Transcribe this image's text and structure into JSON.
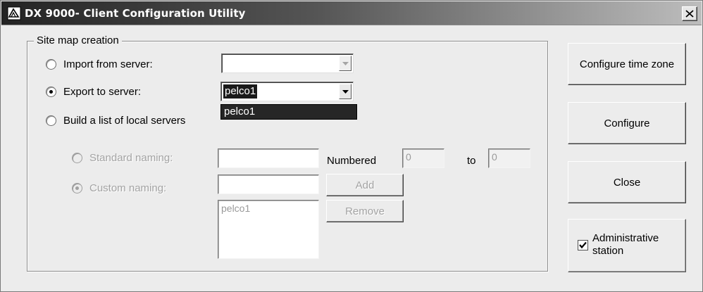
{
  "window": {
    "title": "DX 9000- Client Configuration Utility"
  },
  "site_map": {
    "legend": "Site map creation",
    "import_label": "Import from server:",
    "import_value": "",
    "export_label": "Export to server:",
    "export_value": "pelco1",
    "dropdown_options": [
      "pelco1"
    ],
    "build_label": "Build a list of local servers",
    "selected_option": "export"
  },
  "naming": {
    "standard_label": "Standard naming:",
    "standard_value": "",
    "numbered_label": "Numbered",
    "from_value": "0",
    "to_label": "to",
    "to_value": "0",
    "custom_label": "Custom naming:",
    "custom_value": "",
    "add_label": "Add",
    "remove_label": "Remove",
    "list_items": [
      "pelco1"
    ]
  },
  "actions": {
    "configure_time_zone": "Configure time zone",
    "configure": "Configure",
    "close": "Close"
  },
  "admin_station": {
    "label_line1": "Administrative",
    "label_line2": "station",
    "checked": true
  },
  "icons": {
    "app": "app-window-icon",
    "close": "close-icon",
    "dropdown": "chevron-down-icon",
    "check": "checkmark-icon"
  }
}
